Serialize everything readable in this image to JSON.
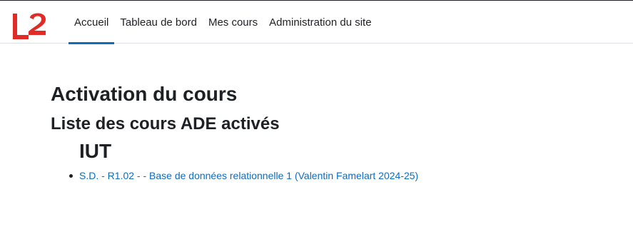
{
  "header": {
    "logo_text": "L2",
    "nav": [
      {
        "label": "Accueil",
        "active": true
      },
      {
        "label": "Tableau de bord",
        "active": false
      },
      {
        "label": "Mes cours",
        "active": false
      },
      {
        "label": "Administration du site",
        "active": false
      }
    ]
  },
  "main": {
    "page_title": "Activation du cours",
    "section_title": "Liste des cours ADE activés",
    "category": "IUT",
    "courses": [
      {
        "label": "S.D. - R1.02 - - Base de données relationnelle 1 (Valentin Famelart 2024-25)"
      }
    ]
  },
  "colors": {
    "accent": "#0f6cbf",
    "logo": "#e02b27",
    "text": "#1d2125"
  }
}
